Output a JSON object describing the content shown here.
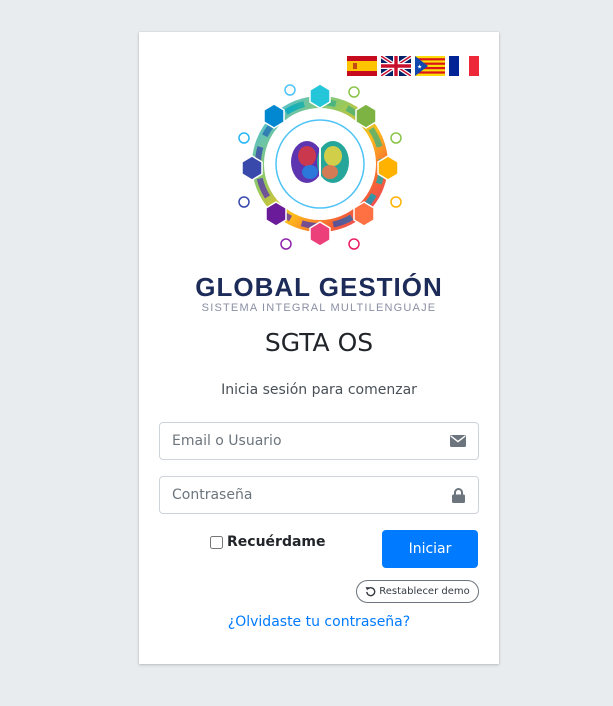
{
  "languages": [
    {
      "code": "es",
      "icon": "spain-flag-icon"
    },
    {
      "code": "en",
      "icon": "uk-flag-icon"
    },
    {
      "code": "ca",
      "icon": "catalonia-flag-icon"
    },
    {
      "code": "fr",
      "icon": "france-flag-icon"
    }
  ],
  "brand": {
    "name": "GLOBAL GESTIÓN",
    "tagline": "SISTEMA INTEGRAL MULTILENGUAJE"
  },
  "login": {
    "title": "SGTA OS",
    "subtitle": "Inicia sesión para comenzar",
    "email_placeholder": "Email o Usuario",
    "email_value": "",
    "password_placeholder": "Contraseña",
    "password_value": "",
    "remember_label": "Recuérdame",
    "remember_checked": false,
    "submit_label": "Iniciar",
    "reset_label": "Restablecer demo",
    "forgot_label": "¿Olvidaste tu contraseña?"
  },
  "colors": {
    "background": "#e9ecef",
    "primary": "#007bff",
    "brand_navy": "#1c2b58"
  }
}
